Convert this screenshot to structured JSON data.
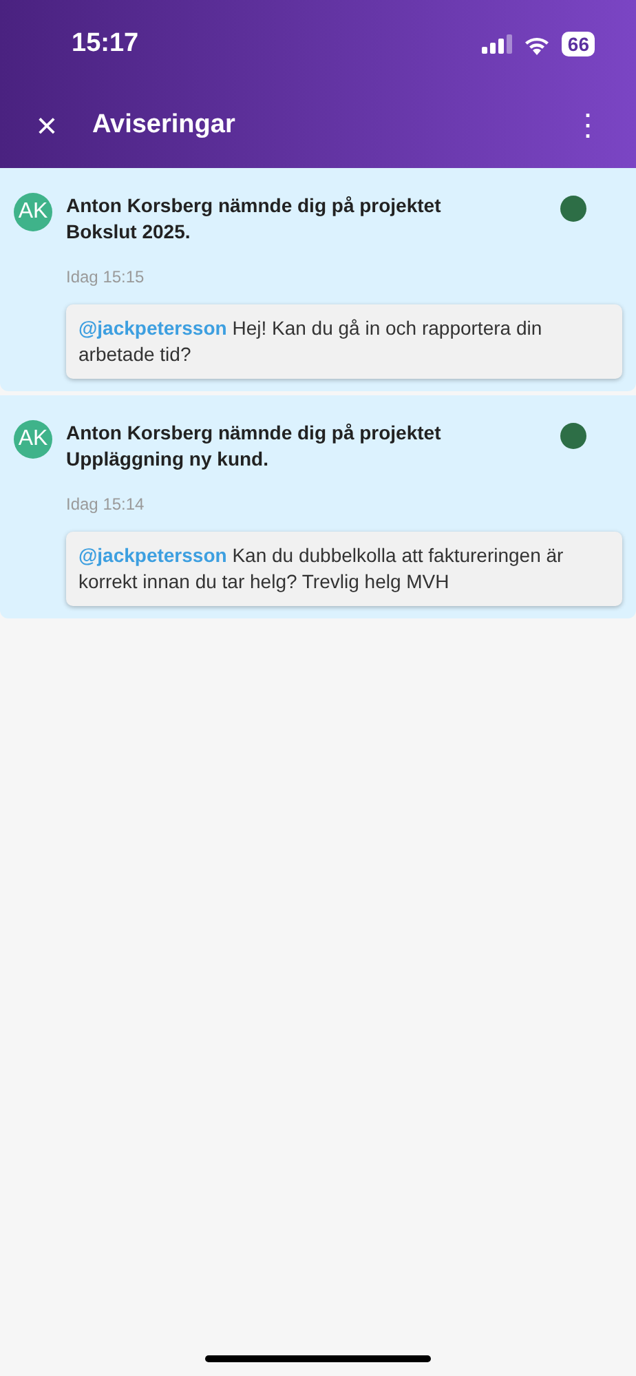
{
  "status_bar": {
    "time": "15:17",
    "battery": "66"
  },
  "header": {
    "close": "×",
    "title": "Aviseringar",
    "menu": "⋮"
  },
  "notifications": [
    {
      "initials": "AK",
      "title": "Anton Korsberg nämnde dig på projektet Bokslut 2025.",
      "unread": true,
      "time": "Idag 15:15",
      "mention": "@jackpetersson",
      "message": "Hej! Kan du gå in och rapportera din arbetade tid?"
    },
    {
      "initials": "AK",
      "title": "Anton Korsberg nämnde dig på projektet Uppläggning ny kund.",
      "unread": true,
      "time": "Idag 15:14",
      "mention": "@jackpetersson",
      "message": "Kan du dubbelkolla att faktureringen är korrekt innan du tar helg? Trevlig helg MVH"
    }
  ]
}
